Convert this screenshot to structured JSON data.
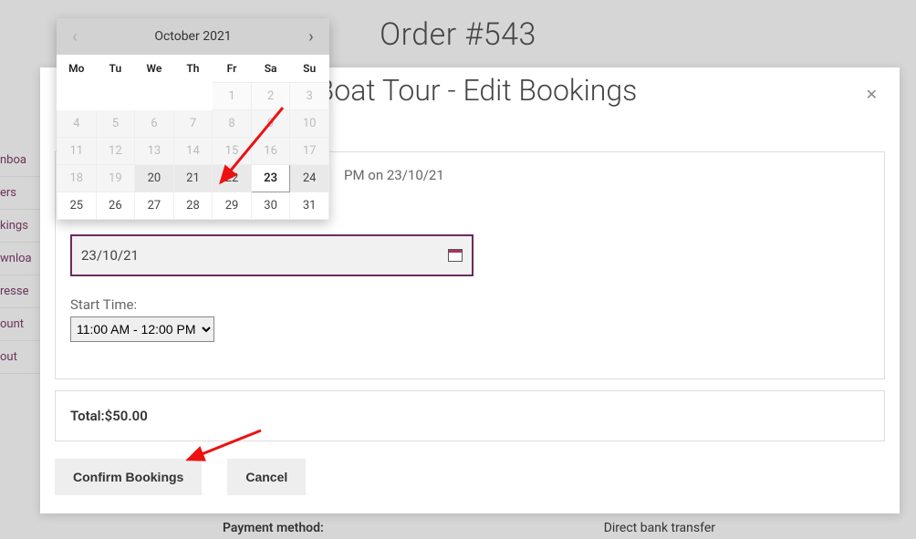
{
  "page": {
    "title": "Order #543"
  },
  "sidebar": {
    "items": [
      {
        "label": "nboa"
      },
      {
        "label": "ers"
      },
      {
        "label": "kings"
      },
      {
        "label": "wnloa"
      },
      {
        "label": "resse"
      },
      {
        "label": "ount"
      },
      {
        "label": "out"
      }
    ]
  },
  "modal": {
    "title": "l Boat Tour - Edit Bookings",
    "close": "✕",
    "booking_line": "PM on 23/10/21",
    "date_value": "23/10/21",
    "start_time_label": "Start Time:",
    "time_selected": "11:00 AM - 12:00 PM",
    "total_label": "Total: ",
    "total_value": "$50.00",
    "confirm_label": "Confirm Bookings",
    "cancel_label": "Cancel"
  },
  "calendar": {
    "month_label": "October 2021",
    "weekdays": [
      "Mo",
      "Tu",
      "We",
      "Th",
      "Fr",
      "Sa",
      "Su"
    ],
    "rows": [
      [
        {
          "t": "",
          "cls": "empty"
        },
        {
          "t": "",
          "cls": "empty"
        },
        {
          "t": "",
          "cls": "empty"
        },
        {
          "t": "",
          "cls": "empty"
        },
        {
          "t": "1",
          "cls": "muted"
        },
        {
          "t": "2",
          "cls": "muted"
        },
        {
          "t": "3",
          "cls": "muted"
        }
      ],
      [
        {
          "t": "4",
          "cls": "muted2"
        },
        {
          "t": "5",
          "cls": "muted2"
        },
        {
          "t": "6",
          "cls": "muted2"
        },
        {
          "t": "7",
          "cls": "muted2"
        },
        {
          "t": "8",
          "cls": "muted2"
        },
        {
          "t": "9",
          "cls": "muted2"
        },
        {
          "t": "10",
          "cls": "muted2"
        }
      ],
      [
        {
          "t": "11",
          "cls": "muted2"
        },
        {
          "t": "12",
          "cls": "muted2"
        },
        {
          "t": "13",
          "cls": "muted2"
        },
        {
          "t": "14",
          "cls": "muted2"
        },
        {
          "t": "15",
          "cls": "muted2"
        },
        {
          "t": "16",
          "cls": "muted2"
        },
        {
          "t": "17",
          "cls": "muted2"
        }
      ],
      [
        {
          "t": "18",
          "cls": "muted2"
        },
        {
          "t": "19",
          "cls": "muted2"
        },
        {
          "t": "20",
          "cls": "range"
        },
        {
          "t": "21",
          "cls": "range"
        },
        {
          "t": "22",
          "cls": "range"
        },
        {
          "t": "23",
          "cls": "selected"
        },
        {
          "t": "24",
          "cls": "range"
        }
      ],
      [
        {
          "t": "25",
          "cls": ""
        },
        {
          "t": "26",
          "cls": ""
        },
        {
          "t": "27",
          "cls": ""
        },
        {
          "t": "28",
          "cls": ""
        },
        {
          "t": "29",
          "cls": ""
        },
        {
          "t": "30",
          "cls": ""
        },
        {
          "t": "31",
          "cls": ""
        }
      ]
    ]
  },
  "below": {
    "payment_label": "Payment method:",
    "payment_value": "Direct bank transfer"
  }
}
